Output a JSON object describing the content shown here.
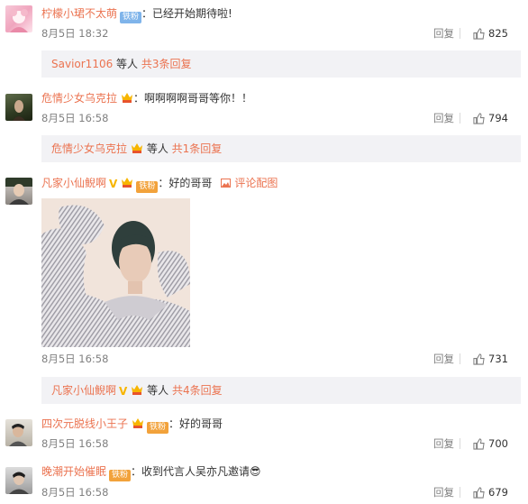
{
  "colors": {
    "username": "#eb7350",
    "meta": "#808080",
    "subbox_bg": "#f2f2f5",
    "fan_badge": "#f2a23b"
  },
  "comments": [
    {
      "user": "柠檬小珺不太萌",
      "badge": "铁粉",
      "text": "：已经开始期待啦!",
      "date": "8月5日 18:32",
      "reply": "回复",
      "likes": "825",
      "sub": {
        "names": "Savior1106",
        "mid": " 等人 ",
        "more": "共3条回复"
      }
    },
    {
      "user": "危情少女乌克拉",
      "text": "：啊啊啊啊哥哥等你！！",
      "date": "8月5日 16:58",
      "reply": "回复",
      "likes": "794",
      "sub": {
        "names": "危情少女乌克拉",
        "mid": " 等人 ",
        "more": "共1条回复"
      }
    },
    {
      "user": "凡家小仙鲵啊",
      "badge": "铁粉",
      "text": "：好的哥哥",
      "pic_link": "评论配图",
      "date": "8月5日 16:58",
      "reply": "回复",
      "likes": "731",
      "sub": {
        "names": "凡家小仙鲵啊",
        "mid": " 等人 ",
        "more": "共4条回复"
      }
    },
    {
      "user": "四次元脱线小王子",
      "badge": "铁粉",
      "text": "：好的哥哥",
      "date": "8月5日 16:58",
      "reply": "回复",
      "likes": "700"
    },
    {
      "user": "晚潮开始催眠",
      "badge": "铁粉",
      "text": "：收到代言人吴亦凡邀请😎",
      "date": "8月5日 16:58",
      "reply": "回复",
      "likes": "679"
    }
  ]
}
